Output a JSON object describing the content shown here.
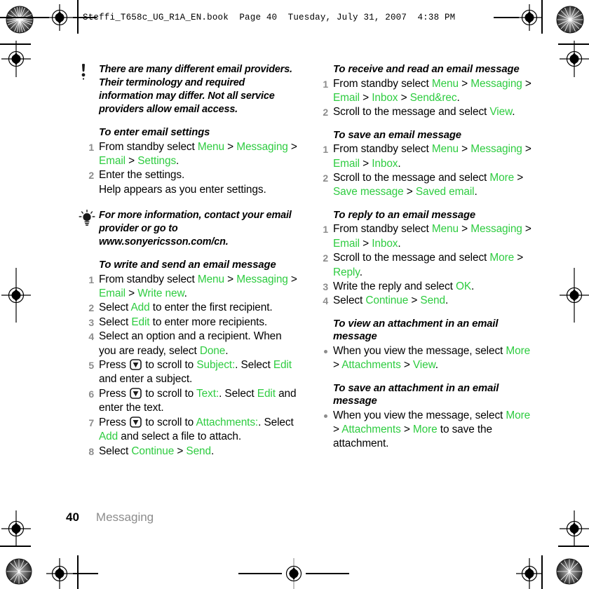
{
  "header": {
    "text": "Steffi_T658c_UG_R1A_EN.book  Page 40  Tuesday, July 31, 2007  4:38 PM"
  },
  "footer": {
    "page_number": "40",
    "section": "Messaging"
  },
  "left_column": {
    "note": {
      "icon": "exclamation-note-icon",
      "text": "There are many different email providers. Their terminology and required information may differ. Not all service providers allow email access."
    },
    "section1": {
      "heading": "To enter email settings",
      "steps": [
        {
          "num": "1",
          "parts": [
            {
              "t": "From standby select ",
              "c": "black"
            },
            {
              "t": "Menu",
              "c": "green"
            },
            {
              "t": " > ",
              "c": "black"
            },
            {
              "t": "Messaging",
              "c": "green"
            },
            {
              "t": " > ",
              "c": "black"
            },
            {
              "t": "Email",
              "c": "green"
            },
            {
              "t": " > ",
              "c": "black"
            },
            {
              "t": "Settings",
              "c": "green"
            },
            {
              "t": ".",
              "c": "black"
            }
          ]
        },
        {
          "num": "2",
          "parts": [
            {
              "t": "Enter the settings.",
              "c": "black"
            },
            {
              "t": "\n",
              "c": "break"
            },
            {
              "t": "Help appears as you enter settings.",
              "c": "black"
            }
          ]
        }
      ]
    },
    "tip": {
      "icon": "lightbulb-tip-icon",
      "text": "For more information, contact your email provider or go to www.sonyericsson.com/cn."
    },
    "section2": {
      "heading": "To write and send an email message",
      "steps": [
        {
          "num": "1",
          "parts": [
            {
              "t": "From standby select ",
              "c": "black"
            },
            {
              "t": "Menu",
              "c": "green"
            },
            {
              "t": " > ",
              "c": "black"
            },
            {
              "t": "Messaging",
              "c": "green"
            },
            {
              "t": " > ",
              "c": "black"
            },
            {
              "t": "Email",
              "c": "green"
            },
            {
              "t": " > ",
              "c": "black"
            },
            {
              "t": "Write new",
              "c": "green"
            },
            {
              "t": ".",
              "c": "black"
            }
          ]
        },
        {
          "num": "2",
          "parts": [
            {
              "t": "Select ",
              "c": "black"
            },
            {
              "t": "Add",
              "c": "green"
            },
            {
              "t": " to enter the first recipient.",
              "c": "black"
            }
          ]
        },
        {
          "num": "3",
          "parts": [
            {
              "t": "Select ",
              "c": "black"
            },
            {
              "t": "Edit",
              "c": "green"
            },
            {
              "t": " to enter more recipients.",
              "c": "black"
            }
          ]
        },
        {
          "num": "4",
          "parts": [
            {
              "t": "Select an option and a recipient. When you are ready, select ",
              "c": "black"
            },
            {
              "t": "Done",
              "c": "green"
            },
            {
              "t": ".",
              "c": "black"
            }
          ]
        },
        {
          "num": "5",
          "parts": [
            {
              "t": "Press ",
              "c": "black"
            },
            {
              "t": "",
              "c": "keyicon"
            },
            {
              "t": " to scroll to ",
              "c": "black"
            },
            {
              "t": "Subject:",
              "c": "green"
            },
            {
              "t": ". Select ",
              "c": "black"
            },
            {
              "t": "Edit",
              "c": "green"
            },
            {
              "t": " and enter a subject.",
              "c": "black"
            }
          ]
        },
        {
          "num": "6",
          "parts": [
            {
              "t": "Press ",
              "c": "black"
            },
            {
              "t": "",
              "c": "keyicon"
            },
            {
              "t": " to scroll to ",
              "c": "black"
            },
            {
              "t": "Text:",
              "c": "green"
            },
            {
              "t": ". Select ",
              "c": "black"
            },
            {
              "t": "Edit",
              "c": "green"
            },
            {
              "t": " and enter the text.",
              "c": "black"
            }
          ]
        },
        {
          "num": "7",
          "parts": [
            {
              "t": "Press ",
              "c": "black"
            },
            {
              "t": "",
              "c": "keyicon"
            },
            {
              "t": " to scroll to ",
              "c": "black"
            },
            {
              "t": "Attachments:",
              "c": "green"
            },
            {
              "t": ". Select ",
              "c": "black"
            },
            {
              "t": "Add",
              "c": "green"
            },
            {
              "t": " and select a file to attach.",
              "c": "black"
            }
          ]
        },
        {
          "num": "8",
          "parts": [
            {
              "t": "Select ",
              "c": "black"
            },
            {
              "t": "Continue",
              "c": "green"
            },
            {
              "t": " > ",
              "c": "black"
            },
            {
              "t": "Send",
              "c": "green"
            },
            {
              "t": ".",
              "c": "black"
            }
          ]
        }
      ]
    }
  },
  "right_column": {
    "section1": {
      "heading": "To receive and read an email message",
      "steps": [
        {
          "num": "1",
          "parts": [
            {
              "t": "From standby select ",
              "c": "black"
            },
            {
              "t": "Menu",
              "c": "green"
            },
            {
              "t": " > ",
              "c": "black"
            },
            {
              "t": "Messaging",
              "c": "green"
            },
            {
              "t": " > ",
              "c": "black"
            },
            {
              "t": "Email",
              "c": "green"
            },
            {
              "t": " > ",
              "c": "black"
            },
            {
              "t": "Inbox",
              "c": "green"
            },
            {
              "t": " > ",
              "c": "black"
            },
            {
              "t": "Send&rec",
              "c": "green"
            },
            {
              "t": ".",
              "c": "black"
            }
          ]
        },
        {
          "num": "2",
          "parts": [
            {
              "t": "Scroll to the message and select ",
              "c": "black"
            },
            {
              "t": "View",
              "c": "green"
            },
            {
              "t": ".",
              "c": "black"
            }
          ]
        }
      ]
    },
    "section2": {
      "heading": "To save an email message",
      "steps": [
        {
          "num": "1",
          "parts": [
            {
              "t": "From standby select ",
              "c": "black"
            },
            {
              "t": "Menu",
              "c": "green"
            },
            {
              "t": " > ",
              "c": "black"
            },
            {
              "t": "Messaging",
              "c": "green"
            },
            {
              "t": " > ",
              "c": "black"
            },
            {
              "t": "Email",
              "c": "green"
            },
            {
              "t": " > ",
              "c": "black"
            },
            {
              "t": "Inbox",
              "c": "green"
            },
            {
              "t": ".",
              "c": "black"
            }
          ]
        },
        {
          "num": "2",
          "parts": [
            {
              "t": "Scroll to the message and select ",
              "c": "black"
            },
            {
              "t": "More",
              "c": "green"
            },
            {
              "t": " > ",
              "c": "black"
            },
            {
              "t": "Save message",
              "c": "green"
            },
            {
              "t": " > ",
              "c": "black"
            },
            {
              "t": "Saved email",
              "c": "green"
            },
            {
              "t": ".",
              "c": "black"
            }
          ]
        }
      ]
    },
    "section3": {
      "heading": "To reply to an email message",
      "steps": [
        {
          "num": "1",
          "parts": [
            {
              "t": "From standby select ",
              "c": "black"
            },
            {
              "t": "Menu",
              "c": "green"
            },
            {
              "t": " > ",
              "c": "black"
            },
            {
              "t": "Messaging",
              "c": "green"
            },
            {
              "t": " > ",
              "c": "black"
            },
            {
              "t": "Email",
              "c": "green"
            },
            {
              "t": " > ",
              "c": "black"
            },
            {
              "t": "Inbox",
              "c": "green"
            },
            {
              "t": ".",
              "c": "black"
            }
          ]
        },
        {
          "num": "2",
          "parts": [
            {
              "t": "Scroll to the message and select ",
              "c": "black"
            },
            {
              "t": "More",
              "c": "green"
            },
            {
              "t": " > ",
              "c": "black"
            },
            {
              "t": "Reply",
              "c": "green"
            },
            {
              "t": ".",
              "c": "black"
            }
          ]
        },
        {
          "num": "3",
          "parts": [
            {
              "t": "Write the reply and select ",
              "c": "black"
            },
            {
              "t": "OK",
              "c": "green"
            },
            {
              "t": ".",
              "c": "black"
            }
          ]
        },
        {
          "num": "4",
          "parts": [
            {
              "t": "Select ",
              "c": "black"
            },
            {
              "t": "Continue",
              "c": "green"
            },
            {
              "t": " > ",
              "c": "black"
            },
            {
              "t": "Send",
              "c": "green"
            },
            {
              "t": ".",
              "c": "black"
            }
          ]
        }
      ]
    },
    "section4": {
      "heading": "To view an attachment in an email message",
      "bullets": [
        {
          "parts": [
            {
              "t": "When you view the message, select ",
              "c": "black"
            },
            {
              "t": "More",
              "c": "green"
            },
            {
              "t": " > ",
              "c": "black"
            },
            {
              "t": "Attachments",
              "c": "green"
            },
            {
              "t": " > ",
              "c": "black"
            },
            {
              "t": "View",
              "c": "green"
            },
            {
              "t": ".",
              "c": "black"
            }
          ]
        }
      ]
    },
    "section5": {
      "heading": "To save an attachment in an email message",
      "bullets": [
        {
          "parts": [
            {
              "t": "When you view the message, select ",
              "c": "black"
            },
            {
              "t": "More",
              "c": "green"
            },
            {
              "t": " > ",
              "c": "black"
            },
            {
              "t": "Attachments",
              "c": "green"
            },
            {
              "t": " > ",
              "c": "black"
            },
            {
              "t": "More",
              "c": "green"
            },
            {
              "t": " to save the attachment.",
              "c": "black"
            }
          ]
        }
      ]
    }
  },
  "colors": {
    "accent_green": "#2ecc40",
    "number_grey": "#8c8c8c",
    "text_black": "#000000"
  },
  "print_marks": {
    "registration_target": "registration-target-icon",
    "color_burst": "color-burst-icon"
  }
}
